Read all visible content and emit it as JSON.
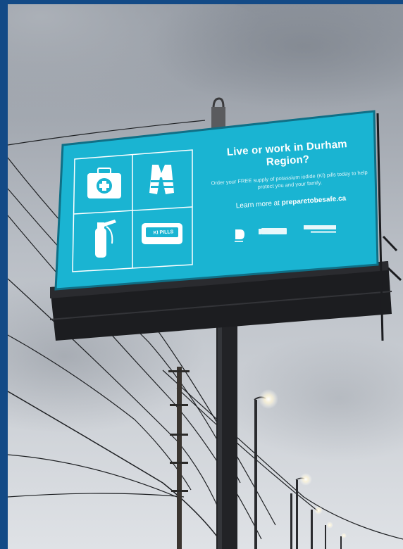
{
  "photo": {
    "subject": "digital-billboard",
    "colors": {
      "frame": "#134a86",
      "sky_top": "#9aa0a8",
      "sky_bottom": "#dde0e4",
      "billboard_screen": "#1ab4d2",
      "billboard_frame": "#1c1d20",
      "pole": "#222326"
    }
  },
  "billboard": {
    "headline": "Live or work in Durham Region?",
    "body": "Order your FREE supply of potassium iodide (KI) pills today to help protect you and your family.",
    "learn_more_prefix": "Learn more at ",
    "learn_more_url": "preparetobesafe.ca",
    "ki_label": "KI PILLS",
    "icons": [
      "first-aid-kit-icon",
      "life-vest-icon",
      "fire-extinguisher-icon",
      "ki-pills-icon"
    ]
  }
}
